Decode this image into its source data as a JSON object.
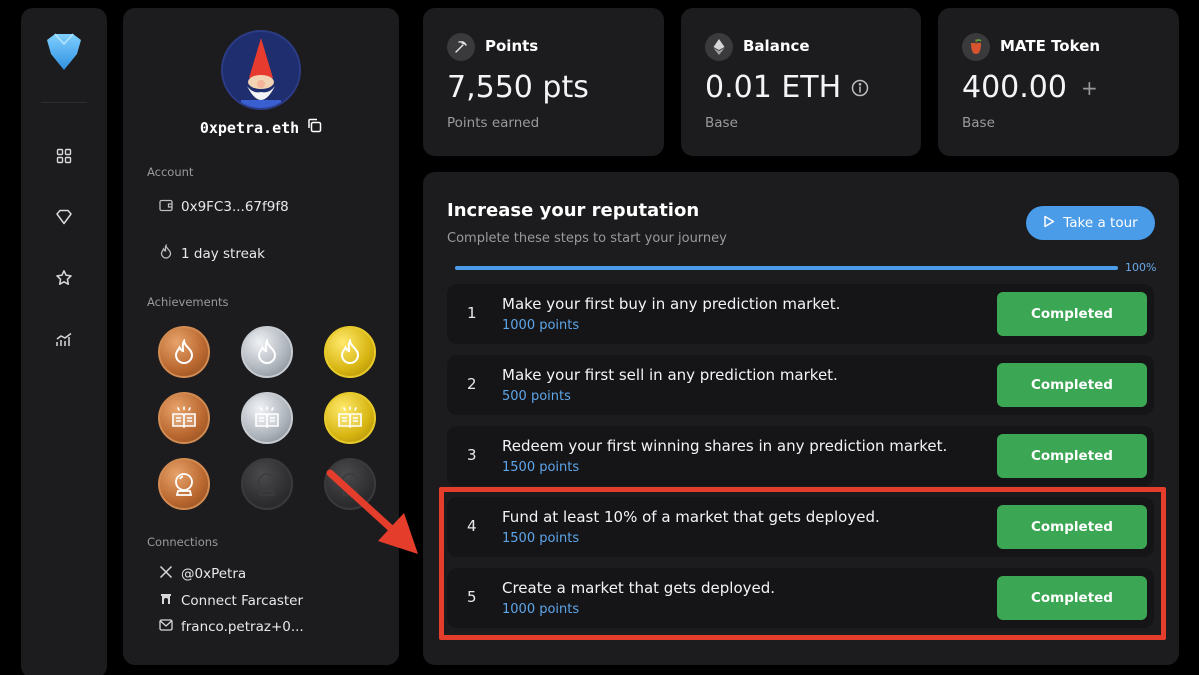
{
  "sidebar": {
    "icons": [
      "gem-logo-icon",
      "grid-icon",
      "diamond-icon",
      "star-icon",
      "chart-icon"
    ]
  },
  "profile": {
    "ens_name": "0xpetra.eth",
    "account_label": "Account",
    "address": "0x9FC3...67f9f8",
    "streak": "1 day streak",
    "achievements_label": "Achievements",
    "connections_label": "Connections",
    "connections": [
      {
        "icon": "x-logo-icon",
        "text": "@0xPetra"
      },
      {
        "icon": "farcaster-icon",
        "text": "Connect Farcaster"
      },
      {
        "icon": "mail-icon",
        "text": "franco.petraz+0..."
      }
    ],
    "badges": [
      {
        "tier": "bronze",
        "icon": "flame-icon"
      },
      {
        "tier": "silver",
        "icon": "flame-icon"
      },
      {
        "tier": "gold",
        "icon": "flame-icon"
      },
      {
        "tier": "bronze",
        "icon": "book-icon"
      },
      {
        "tier": "silver",
        "icon": "book-icon"
      },
      {
        "tier": "gold",
        "icon": "book-icon"
      },
      {
        "tier": "bronze",
        "icon": "crystal-ball-icon"
      },
      {
        "tier": "locked",
        "icon": "crystal-ball-icon"
      },
      {
        "tier": "locked",
        "icon": "crystal-ball-icon"
      }
    ]
  },
  "stats": {
    "points": {
      "label": "Points",
      "value": "7,550 pts",
      "sub": "Points earned"
    },
    "balance": {
      "label": "Balance",
      "value": "0.01 ETH",
      "sub": "Base"
    },
    "mate": {
      "label": "MATE Token",
      "value": "400.00",
      "action": "+",
      "sub": "Base"
    }
  },
  "reputation": {
    "title": "Increase your reputation",
    "subtitle": "Complete these steps to start your journey",
    "tour_label": "Take a tour",
    "progress_percent": 100,
    "progress_label": "100%",
    "steps": [
      {
        "num": "1",
        "text": "Make your first buy in any prediction market.",
        "points": "1000 points",
        "status": "Completed"
      },
      {
        "num": "2",
        "text": "Make your first sell in any prediction market.",
        "points": "500 points",
        "status": "Completed"
      },
      {
        "num": "3",
        "text": "Redeem your first winning shares in any prediction market.",
        "points": "1500 points",
        "status": "Completed"
      },
      {
        "num": "4",
        "text": "Fund at least 10% of a market that gets deployed.",
        "points": "1500 points",
        "status": "Completed"
      },
      {
        "num": "5",
        "text": "Create a market that gets deployed.",
        "points": "1000 points",
        "status": "Completed"
      }
    ]
  },
  "colors": {
    "accent": "#4a9be8",
    "success": "#3ba654",
    "annotation": "#e53d2c"
  }
}
